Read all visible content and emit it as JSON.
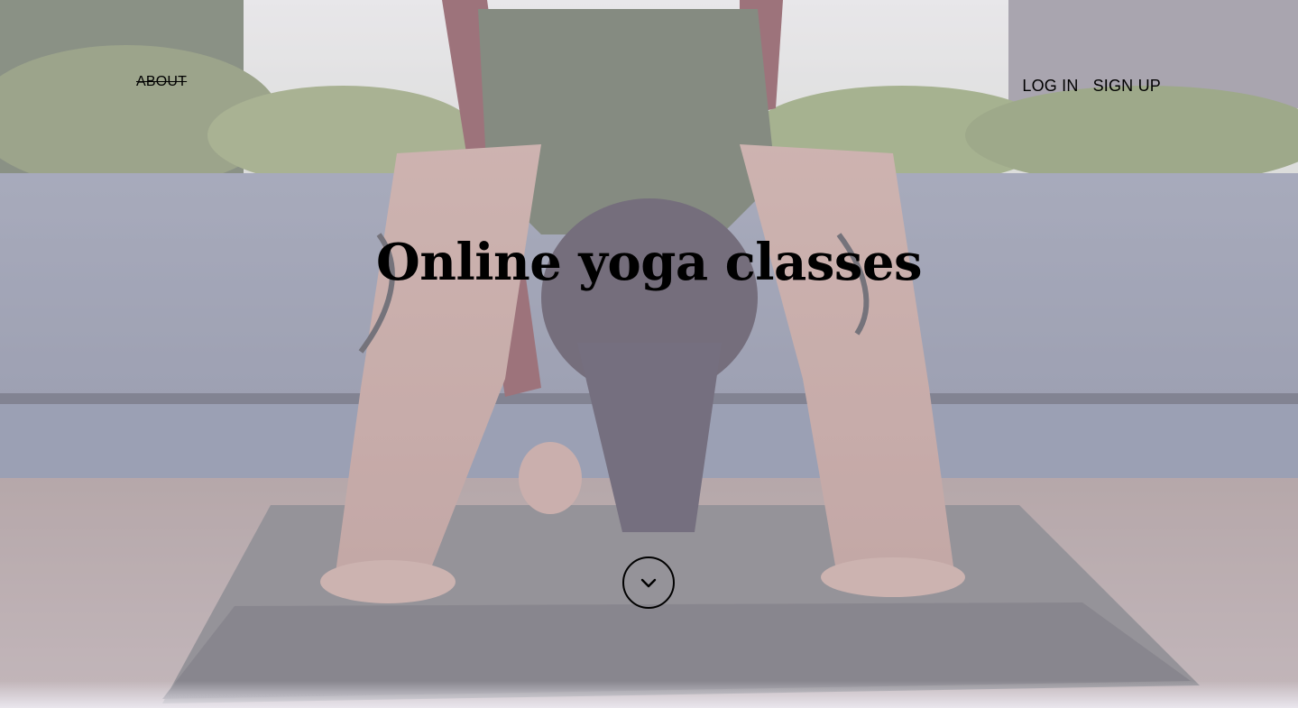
{
  "nav": {
    "about_label": "ABOUT",
    "login_label": "LOG IN",
    "signup_label": "SIGN UP"
  },
  "hero": {
    "title": "Online yoga classes",
    "background": "yoga-plank-photo",
    "overlay_color": "#d6d0e0"
  },
  "scroll_button": {
    "icon": "chevron-down-icon"
  }
}
